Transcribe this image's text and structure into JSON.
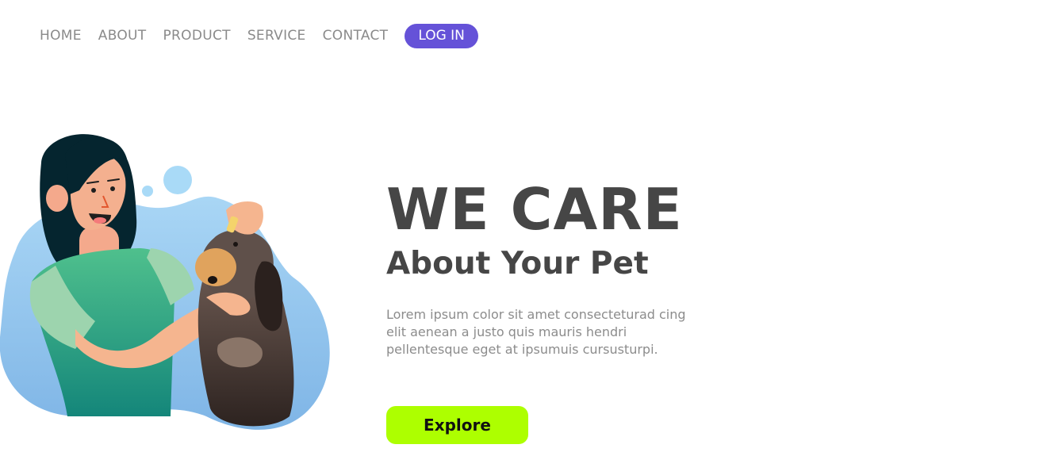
{
  "nav": {
    "items": [
      "HOME",
      "ABOUT",
      "PRODUCT",
      "SERVICE",
      "CONTACT"
    ],
    "login_label": "LOG IN"
  },
  "hero": {
    "title": "WE CARE",
    "subtitle": "About Your Pet",
    "body": "Lorem ipsum color sit amet consecteturad cing elit aenean a justo quis mauris hendri pellentesque eget at ipsumuis cursusturpi.",
    "cta_label": "Explore"
  },
  "illustration": {
    "description_icon": "woman-with-dog-illustration"
  },
  "colors": {
    "accent": "#6552d8",
    "cta": "#adff00",
    "heading": "#464646",
    "nav_text": "#8a8a8a",
    "blob": "#8fc7ee"
  }
}
